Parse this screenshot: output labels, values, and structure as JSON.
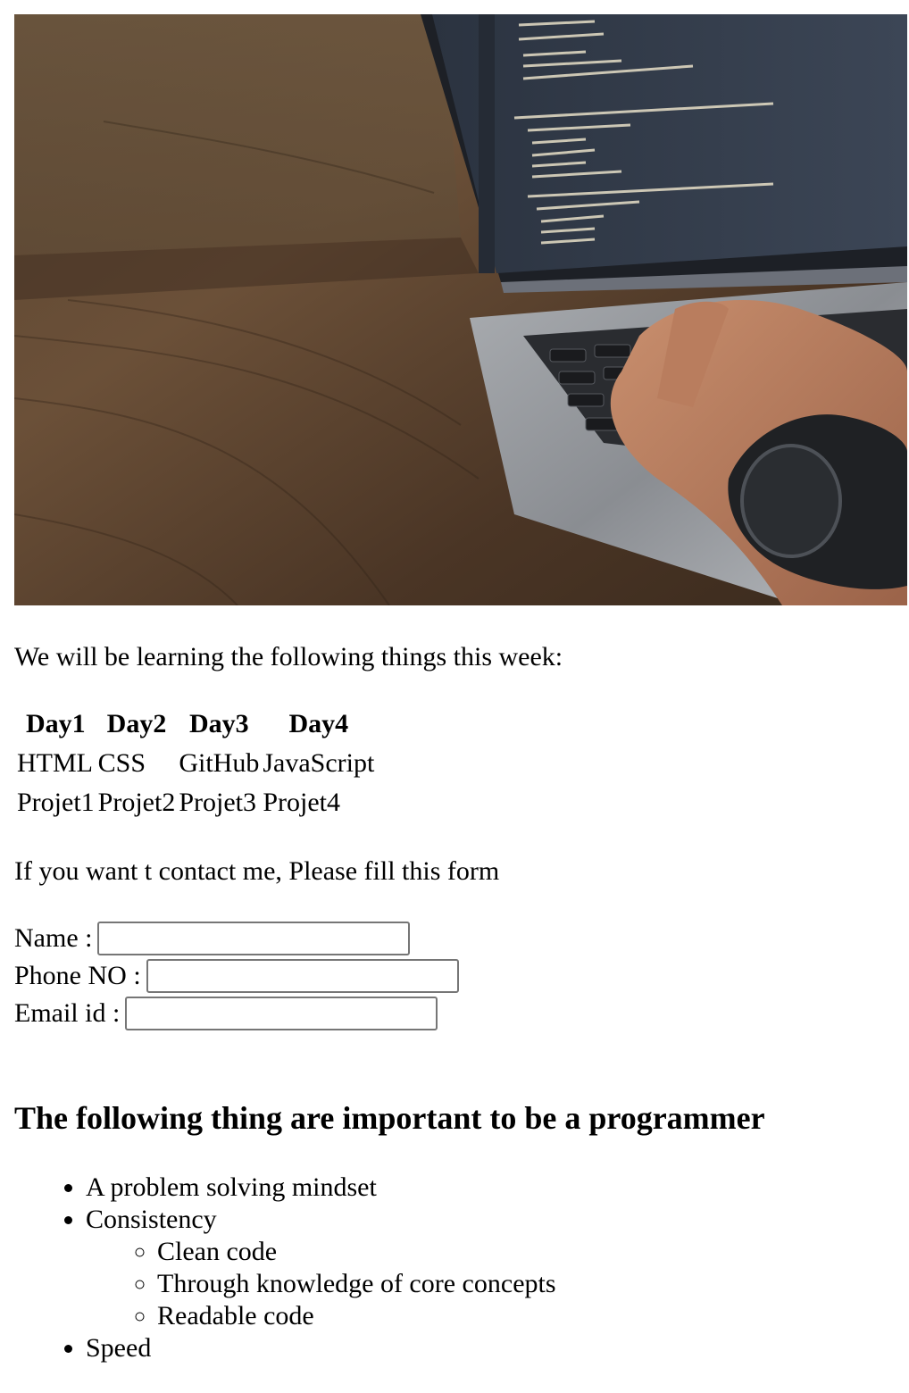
{
  "hero_image": {
    "alt": "Person typing code on a laptop on a wooden desk"
  },
  "intro": {
    "text": "We will be learning the following things this week:"
  },
  "schedule": {
    "headers": [
      "Day1",
      "Day2",
      "Day3",
      "Day4"
    ],
    "rows": [
      [
        "HTML",
        "CSS",
        "GitHub",
        "JavaScript"
      ],
      [
        "Projet1",
        "Projet2",
        "Projet3",
        "Projet4"
      ]
    ]
  },
  "contact": {
    "text": "If you want t contact me, Please fill this form",
    "name_label": "Name :",
    "phone_label": "Phone NO :",
    "email_label": "Email id :",
    "name_value": "",
    "phone_value": "",
    "email_value": ""
  },
  "tips": {
    "heading": "The following thing are important to be a programmer",
    "items": [
      "A problem solving mindset",
      "Consistency",
      "Speed"
    ],
    "subitems": [
      "Clean code",
      "Through knowledge of core concepts",
      "Readable code"
    ]
  }
}
